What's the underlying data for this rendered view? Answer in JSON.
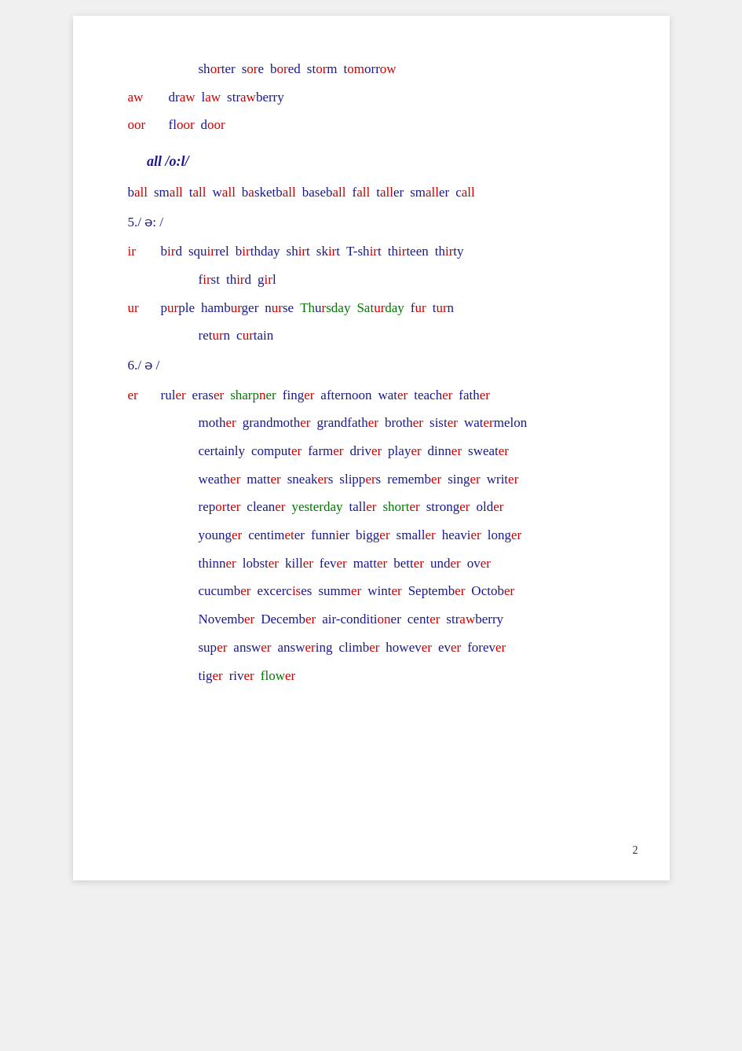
{
  "page_number": "2",
  "lines": [
    {
      "id": "line1",
      "indent": "medium",
      "words": [
        {
          "text": "sh",
          "color": "blue"
        },
        {
          "text": "or",
          "color": "red"
        },
        {
          "text": "ter",
          "color": "blue"
        },
        {
          "text": "s",
          "color": "blue"
        },
        {
          "text": "or",
          "color": "red"
        },
        {
          "text": "e",
          "color": "blue"
        },
        {
          "text": "b",
          "color": "blue"
        },
        {
          "text": "or",
          "color": "red"
        },
        {
          "text": "ed",
          "color": "blue"
        },
        {
          "text": "st",
          "color": "blue"
        },
        {
          "text": "or",
          "color": "red"
        },
        {
          "text": "m",
          "color": "blue"
        },
        {
          "text": "t",
          "color": "blue"
        },
        {
          "text": "om",
          "color": "blue"
        },
        {
          "text": "or",
          "color": "red"
        },
        {
          "text": "row",
          "color": "blue"
        }
      ],
      "type": "mixed_word_list",
      "display": "shorter sore bored storm tomorrow"
    },
    {
      "id": "line2",
      "indent": "none",
      "prefix": "aw",
      "prefix_color": "red",
      "display": "draw law strawberry",
      "words_raw": [
        {
          "w": "draw",
          "parts": [
            {
              "t": "dr",
              "c": "blue"
            },
            {
              "t": "aw",
              "c": "red"
            }
          ]
        },
        {
          "w": "law",
          "parts": [
            {
              "t": "l",
              "c": "blue"
            },
            {
              "t": "aw",
              "c": "red"
            }
          ]
        },
        {
          "w": "strawberry",
          "parts": [
            {
              "t": "str",
              "c": "blue"
            },
            {
              "t": "aw",
              "c": "red"
            },
            {
              "t": "berry",
              "c": "blue"
            }
          ]
        }
      ]
    },
    {
      "id": "line3",
      "indent": "none",
      "prefix": "oor",
      "prefix_color": "red",
      "display": "floor door",
      "words_raw": [
        {
          "w": "floor",
          "parts": [
            {
              "t": "fl",
              "c": "blue"
            },
            {
              "t": "oor",
              "c": "red"
            }
          ]
        },
        {
          "w": "door",
          "parts": [
            {
              "t": "d",
              "c": "blue"
            },
            {
              "t": "oor",
              "c": "red"
            }
          ]
        }
      ]
    },
    {
      "id": "header_all",
      "type": "section_header",
      "text": "all /o:l/"
    },
    {
      "id": "line_ball",
      "indent": "none",
      "display": "ball small tall wall basketball baseball fall taller smaller call"
    },
    {
      "id": "line_5",
      "type": "section_num",
      "text": "5./ ə: /"
    },
    {
      "id": "line_ir",
      "indent": "none",
      "prefix": "ir",
      "prefix_color": "red",
      "display": "bird squirrel birthday shirt skirt T-shirt thirteen thirty"
    },
    {
      "id": "line_first",
      "indent": "large",
      "display": "first third girl"
    },
    {
      "id": "line_ur",
      "indent": "none",
      "prefix": "ur",
      "prefix_color": "red",
      "display": "purple hamburger nurse Thursday Saturday fur turn"
    },
    {
      "id": "line_return",
      "indent": "large",
      "display": "return curtain"
    },
    {
      "id": "line_6",
      "type": "section_num",
      "text": "6./ ə /"
    },
    {
      "id": "line_er",
      "indent": "none",
      "prefix": "er",
      "prefix_color": "red",
      "display": "ruler eraser sharpner finger afternoon water teacher father"
    },
    {
      "id": "line_mother",
      "indent": "large",
      "display": "mother grandmother grandfather brother sister watermelon"
    },
    {
      "id": "line_certainly",
      "indent": "large",
      "display": "certainly computer farmer driver player dinner sweater"
    },
    {
      "id": "line_weather",
      "indent": "large",
      "display": "weather matter sneakers slippers remember singer writer"
    },
    {
      "id": "line_reporter",
      "indent": "large",
      "display": "reporter cleaner yesterday taller shorter stronger older"
    },
    {
      "id": "line_younger",
      "indent": "large",
      "display": "younger centimeter funnier bigger smaller heavier longer"
    },
    {
      "id": "line_thinner",
      "indent": "large",
      "display": "thinner lobster killer fever matter better under over"
    },
    {
      "id": "line_cucumber",
      "indent": "large",
      "display": "cucumber excercises summer winter September October"
    },
    {
      "id": "line_november",
      "indent": "large",
      "display": "November December air-conditioner center strawberry"
    },
    {
      "id": "line_super",
      "indent": "large",
      "display": "super answer answering climber however ever forever"
    },
    {
      "id": "line_tiger",
      "indent": "large",
      "display": "tiger river flower"
    }
  ]
}
